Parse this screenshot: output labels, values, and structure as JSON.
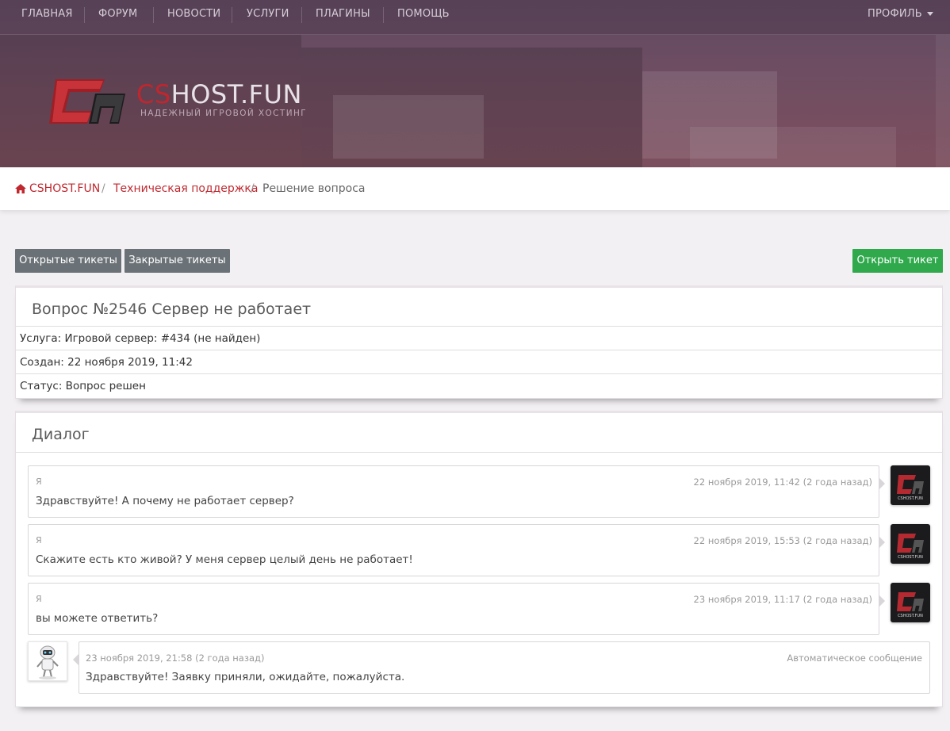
{
  "nav": {
    "items": [
      {
        "label": "ГЛАВНАЯ"
      },
      {
        "label": "ФОРУМ"
      },
      {
        "label": "НОВОСТИ"
      },
      {
        "label": "УСЛУГИ"
      },
      {
        "label": "ПЛАГИНЫ"
      },
      {
        "label": "ПОМОЩЬ"
      }
    ],
    "profile_label": "ПРОФИЛЬ"
  },
  "logo": {
    "brand_cs": "CS",
    "brand_rest": "HOST.FUN",
    "tagline": "НАДЕЖНЫЙ ИГРОВОЙ ХОСТИНГ"
  },
  "breadcrumb": {
    "home": "CSHOST.FUN",
    "section": "Техническая поддержка",
    "current": "Решение вопроса",
    "separator": "/"
  },
  "buttons": {
    "open_tickets": "Открытые тикеты",
    "closed_tickets": "Закрытые тикеты",
    "open_ticket": "Открыть тикет"
  },
  "ticket": {
    "title": "Вопрос №2546 Сервер не работает",
    "service": "Услуга: Игровой сервер: #434 (не найден)",
    "created": "Создан: 22 ноября 2019, 11:42",
    "status": "Статус: Вопрос решен"
  },
  "dialog": {
    "title": "Диалог",
    "messages": [
      {
        "author": "Я",
        "time": "22 ноября 2019, 11:42 (2 года назад)",
        "text": "Здравствуйте! А почему не работает сервер?"
      },
      {
        "author": "Я",
        "time": "22 ноября 2019, 15:53 (2 года назад)",
        "text": "Скажите есть кто живой? У меня сервер целый день не работает!"
      },
      {
        "author": "Я",
        "time": "23 ноября 2019, 11:17 (2 года назад)",
        "text": "вы можете ответить?"
      }
    ],
    "reply": {
      "time": "23 ноября 2019, 21:58 (2 года назад)",
      "label": "Автоматическое сообщение",
      "text": "Здравствуйте! Заявку приняли, ожидайте, пожалуйста."
    },
    "avatar_text": "CSHOST.FUN"
  },
  "colors": {
    "accent": "#c0282f",
    "button_gray": "#6b7277",
    "button_green": "#2fa94c"
  }
}
